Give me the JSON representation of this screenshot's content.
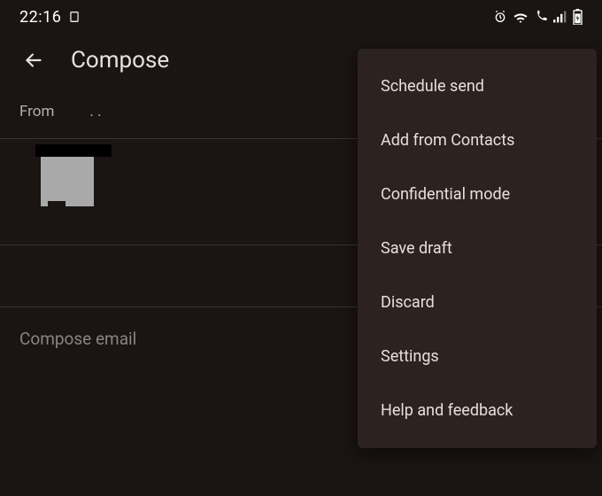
{
  "statusbar": {
    "time": "22:16"
  },
  "appbar": {
    "title": "Compose"
  },
  "from": {
    "label": "From",
    "value": ". ."
  },
  "body": {
    "placeholder": "Compose email"
  },
  "menu": {
    "items": [
      {
        "label": "Schedule send"
      },
      {
        "label": "Add from Contacts"
      },
      {
        "label": "Confidential mode"
      },
      {
        "label": "Save draft"
      },
      {
        "label": "Discard"
      },
      {
        "label": "Settings"
      },
      {
        "label": "Help and feedback"
      }
    ]
  }
}
